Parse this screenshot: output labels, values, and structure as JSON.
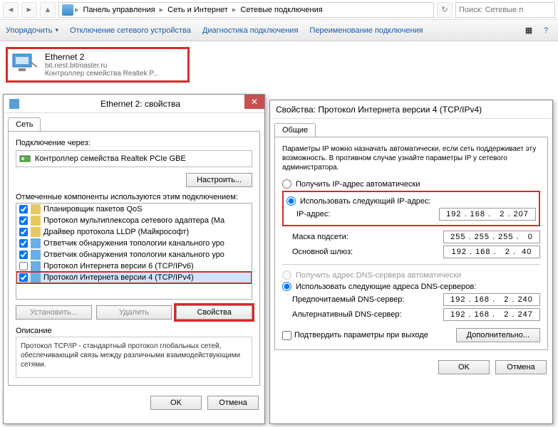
{
  "explorer": {
    "breadcrumb": [
      "Панель управления",
      "Сеть и Интернет",
      "Сетевые подключения"
    ],
    "search_placeholder": "Поиск: Сетевые п"
  },
  "cmdbar": {
    "organize": "Упорядочить",
    "disable": "Отключение сетевого устройства",
    "diagnose": "Диагностика подключения",
    "rename": "Переименование подключения"
  },
  "adapter": {
    "name": "Ethernet 2",
    "domain": "bit.nest.bitmaster.ru",
    "device": "Контроллер семейства Realtek P..."
  },
  "dlg_left": {
    "title": "Ethernet 2: свойства",
    "tab": "Сеть",
    "connect_using_label": "Подключение через:",
    "connect_using_value": "Контроллер семейства Realtek PCIe GBE",
    "configure_btn": "Настроить...",
    "components_label": "Отмеченные компоненты используются этим подключением:",
    "components": [
      {
        "checked": true,
        "label": "Планировщик пакетов QoS",
        "sel": false
      },
      {
        "checked": true,
        "label": "Протокол мультиплексора сетевого адаптера (Ма",
        "sel": false
      },
      {
        "checked": true,
        "label": "Драйвер протокола LLDP (Майкрософт)",
        "sel": false
      },
      {
        "checked": true,
        "label": "Ответчик обнаружения топологии канального уро",
        "sel": false
      },
      {
        "checked": true,
        "label": "Ответчик обнаружения топологии канального уро",
        "sel": false
      },
      {
        "checked": false,
        "label": "Протокол Интернета версии 6 (TCP/IPv6)",
        "sel": false
      },
      {
        "checked": true,
        "label": "Протокол Интернета версии 4 (TCP/IPv4)",
        "sel": true
      }
    ],
    "install_btn": "Установить...",
    "remove_btn": "Удалить",
    "props_btn": "Свойства",
    "desc_label": "Описание",
    "desc_text": "Протокол TCP/IP - стандартный протокол глобальных сетей, обеспечивающий связь между различными взаимодействующими сетями.",
    "ok": "OK",
    "cancel": "Отмена"
  },
  "dlg_right": {
    "title": "Свойства: Протокол Интернета версии 4 (TCP/IPv4)",
    "tab": "Общие",
    "info": "Параметры IP можно назначать автоматически, если сеть поддерживает эту возможность. В противном случае узнайте параметры IP у сетевого администратора.",
    "ip_auto": "Получить IP-адрес автоматически",
    "ip_manual": "Использовать следующий IP-адрес:",
    "ip_label": "IP-адрес:",
    "ip_value": "192 . 168 .   2 . 207",
    "mask_label": "Маска подсети:",
    "mask_value": "255 . 255 . 255 .   0",
    "gw_label": "Основной шлюз:",
    "gw_value": "192 . 168 .   2 .  40",
    "dns_auto": "Получить адрес DNS-сервера автоматически",
    "dns_manual": "Использовать следующие адреса DNS-серверов:",
    "dns1_label": "Предпочитаемый DNS-сервер:",
    "dns1_value": "192 . 168 .   2 . 240",
    "dns2_label": "Альтернативный DNS-сервер:",
    "dns2_value": "192 . 168 .   2 . 247",
    "validate": "Подтвердить параметры при выходе",
    "advanced": "Дополнительно...",
    "ok": "OK",
    "cancel": "Отмена"
  }
}
